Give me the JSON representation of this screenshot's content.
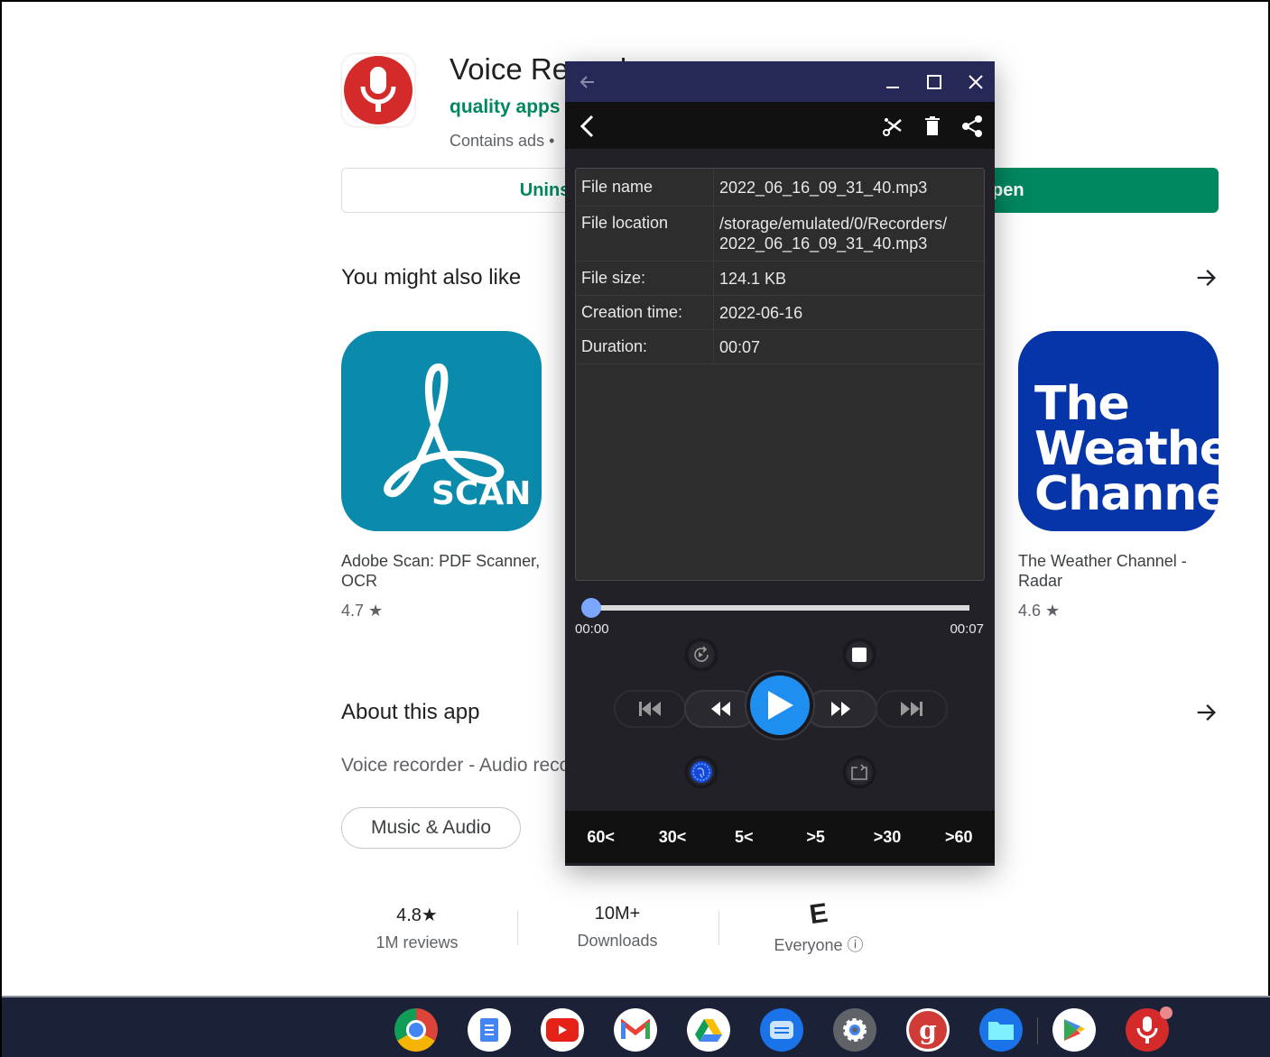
{
  "store": {
    "app_title": "Voice Recorder",
    "developer": "quality apps",
    "contains_ads": "Contains ads  •",
    "uninstall_label": "Uninstall",
    "open_label": "Open",
    "you_might_also_like": "You might also like",
    "recommended": [
      {
        "name": "Adobe Scan: PDF Scanner, OCR",
        "rating": "4.7 ★",
        "icon_text": "SCAN",
        "icon_color": "#0a8bac"
      },
      {
        "name": "The Weather Channel - Radar",
        "rating": "4.6 ★",
        "icon_text": "The Weather Channel",
        "icon_color": "#0535a8"
      }
    ],
    "about_title": "About this app",
    "about_desc": "Voice recorder - Audio recorder",
    "category_chip": "Music & Audio",
    "stats": [
      {
        "value": "4.8★",
        "label": "1M reviews"
      },
      {
        "value": "10M+",
        "label": "Downloads"
      },
      {
        "value": "E",
        "label": "Everyone ⓘ"
      }
    ],
    "accent_color": "#01875f"
  },
  "recorder": {
    "window_colors": {
      "titlebar": "#262858",
      "toolbar": "#111112",
      "body": "#222128",
      "accent": "#1e8ff0"
    },
    "info": [
      {
        "key": "File name",
        "value": "2022_06_16_09_31_40.mp3"
      },
      {
        "key": "File location",
        "value": "/storage/emulated/0/Recorders/\n2022_06_16_09_31_40.mp3"
      },
      {
        "key": "File size:",
        "value": "124.1 KB"
      },
      {
        "key": "Creation time:",
        "value": "2022-06-16"
      },
      {
        "key": "Duration:",
        "value": "00:07"
      }
    ],
    "progress": 0.0,
    "time_current": "00:00",
    "time_total": "00:07",
    "seek_buttons": [
      "60<",
      "30<",
      "5<",
      ">5",
      ">30",
      ">60"
    ]
  },
  "shelf": {
    "apps": [
      "Chrome",
      "Docs",
      "YouTube",
      "Gmail",
      "Drive",
      "Messages",
      "Settings",
      "Grammar",
      "Files",
      "Play Store",
      "Voice Recorder"
    ]
  }
}
